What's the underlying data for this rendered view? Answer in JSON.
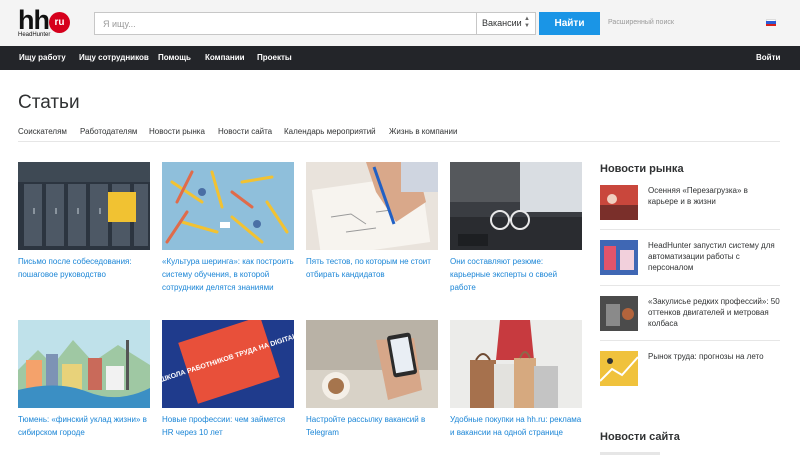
{
  "header": {
    "logo_main": "hh",
    "logo_badge": "ru",
    "logo_sub": "HeadHunter",
    "search_placeholder": "Я ищу...",
    "search_category": "Вакансии",
    "search_button": "Найти",
    "advanced_search": "Расширенный поиск"
  },
  "nav": {
    "items": [
      "Ищу работу",
      "Ищу сотрудников",
      "Помощь",
      "Компании",
      "Проекты"
    ],
    "login": "Войти"
  },
  "page": {
    "title": "Статьи",
    "tabs": [
      "Соискателям",
      "Работодателям",
      "Новости рынка",
      "Новости сайта",
      "Календарь мероприятий",
      "Жизнь в компании"
    ]
  },
  "articles": [
    {
      "title": "Письмо после собеседования: пошаговое руководство"
    },
    {
      "title": "«Культура шеринга»: как построить систему обучения, в которой сотрудники делятся знаниями"
    },
    {
      "title": "Пять тестов, по которым не стоит отбирать кандидатов"
    },
    {
      "title": "Они составляют резюме: карьерные эксперты о своей работе"
    },
    {
      "title": "Тюмень: «финский уклад жизни» в сибирском городе",
      "image_text": ""
    },
    {
      "title": "Новые профессии: чем займется HR через 10 лет",
      "image_text": "ШКОЛА РАБОТНИКОВ ТРУДА НА DIGITAL"
    },
    {
      "title": "Настройте рассылку вакансий в Telegram"
    },
    {
      "title": "Удобные покупки на hh.ru: реклама и вакансии на одной странице"
    }
  ],
  "sidebar": {
    "market_news_title": "Новости рынка",
    "market_news": [
      {
        "title": "Осенняя «Перезагрузка» в карьере и в жизни"
      },
      {
        "title": "HeadHunter запустил систему для автоматизации работы с персоналом"
      },
      {
        "title": "«Закулисье редких профессий»: 50 оттенков двигателей и метровая колбаса"
      },
      {
        "title": "Рынок труда: прогнозы на лето"
      }
    ],
    "site_news_title": "Новости сайта"
  },
  "colors": {
    "accent": "#1a95e6",
    "link": "#1a85d6",
    "brand_red": "#d6001c",
    "nav_bg": "#232529",
    "topbar_bg": "#f4f4f4"
  }
}
